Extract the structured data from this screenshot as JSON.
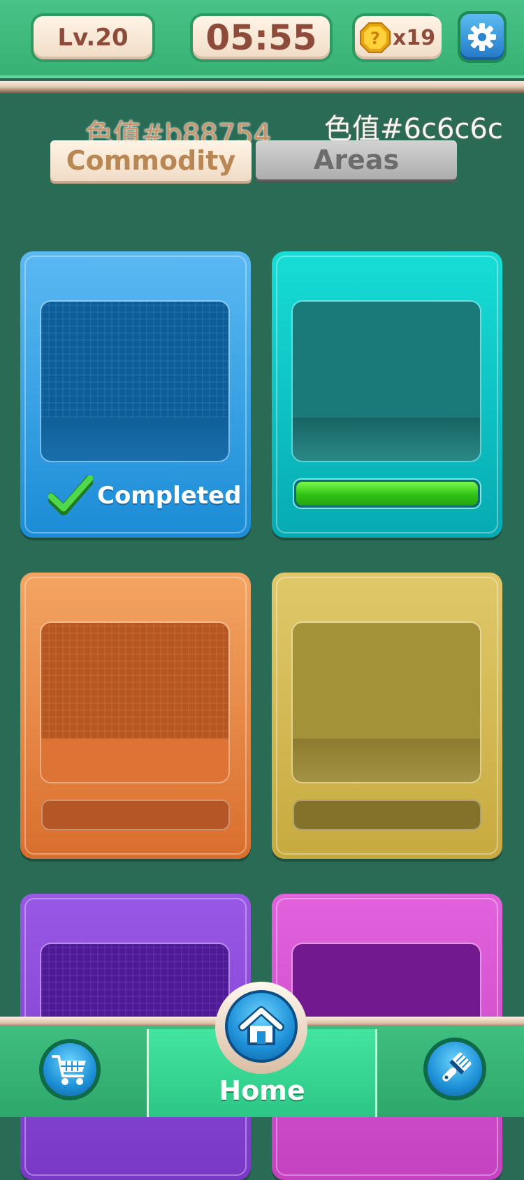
{
  "header": {
    "level": "Lv.20",
    "timer": "05:55",
    "hint_count": "x19",
    "hint_icon": "question-coin-icon",
    "settings_icon": "gear-icon"
  },
  "annotations": {
    "left": "色值#b88754",
    "right": "色值#6c6c6c"
  },
  "tabs": [
    {
      "label": "Commodity",
      "selected": true,
      "color": "#b88754"
    },
    {
      "label": "Areas",
      "selected": false,
      "color": "#6c6c6c"
    }
  ],
  "cards": [
    {
      "color": "#2ea3e6",
      "status": "Completed",
      "status_icon": "checkmark-icon"
    },
    {
      "color": "#0fc4c6",
      "progress": 1.0
    },
    {
      "color": "#e8844a"
    },
    {
      "color": "#d2b653"
    },
    {
      "color": "#8a48d8"
    },
    {
      "color": "#d552d0"
    }
  ],
  "bottom_nav": {
    "shop_icon": "shopping-cart-icon",
    "home_icon": "house-icon",
    "home_label": "Home",
    "decorate_icon": "paint-brush-icon"
  }
}
